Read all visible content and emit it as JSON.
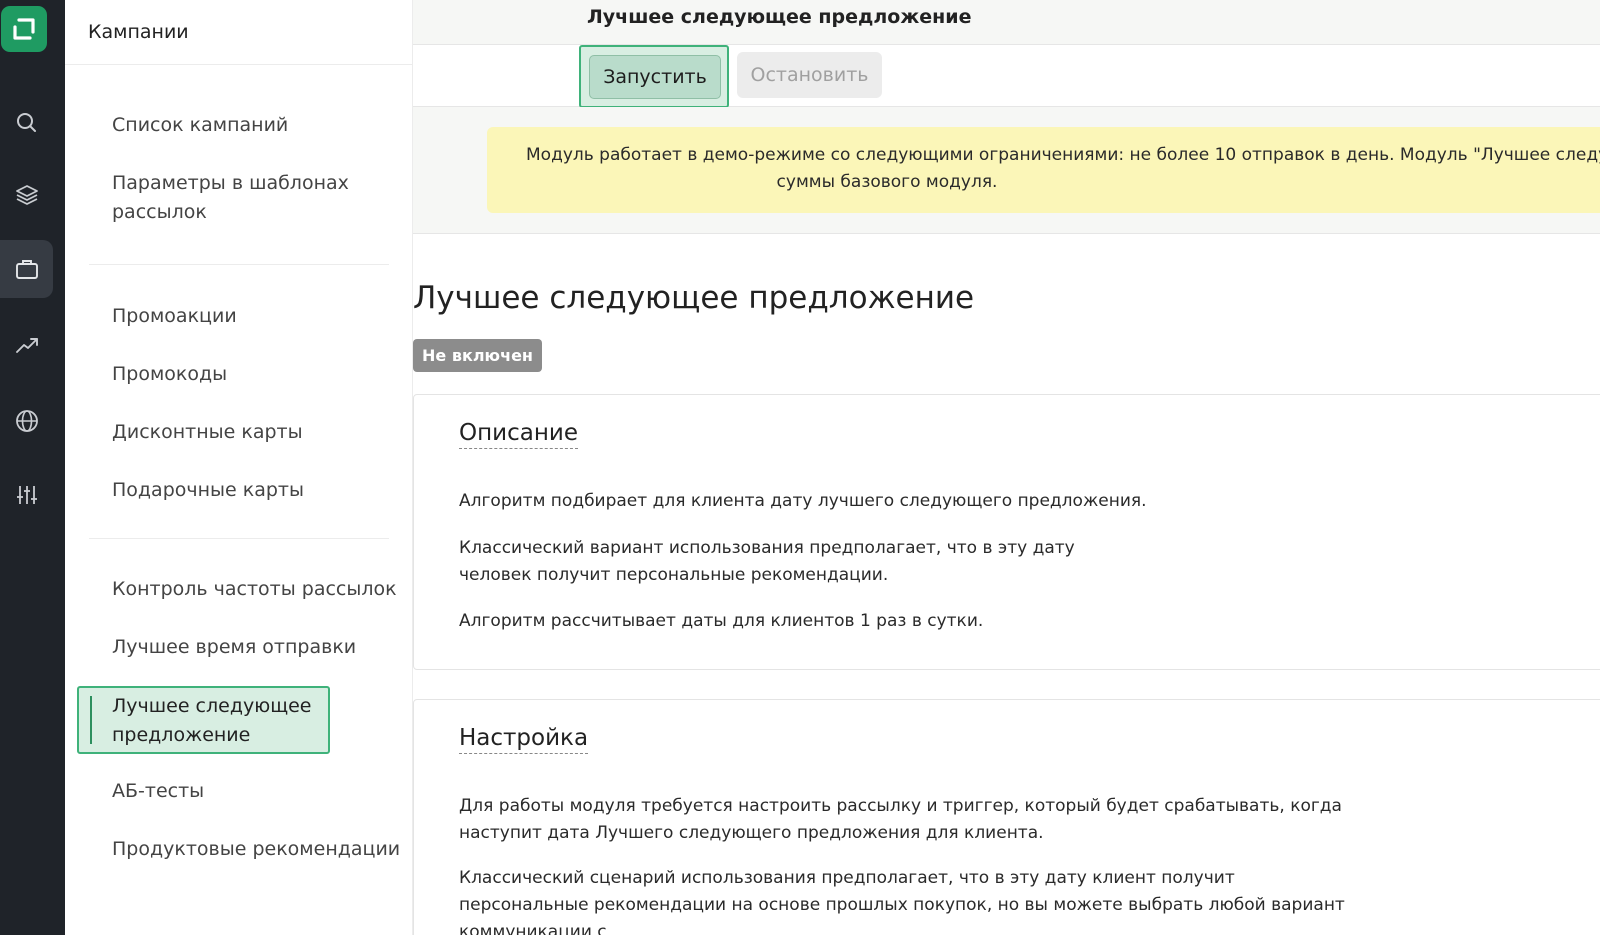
{
  "sidebar": {
    "title": "Кампании",
    "items": [
      {
        "label": "Список кампаний"
      },
      {
        "label": "Параметры в шаблонах рассылок"
      },
      {
        "label": "Промоакции"
      },
      {
        "label": "Промокоды"
      },
      {
        "label": "Дисконтные карты"
      },
      {
        "label": "Подарочные карты"
      },
      {
        "label": "Контроль частоты рассылок"
      },
      {
        "label": "Лучшее время отправки"
      },
      {
        "label": "Лучшее следующее предложение"
      },
      {
        "label": "АБ-тесты"
      },
      {
        "label": "Продуктовые рекомендации"
      }
    ]
  },
  "topbar": {
    "title": "Лучшее следующее предложение"
  },
  "toolbar": {
    "start_label": "Запустить",
    "stop_label": "Остановить"
  },
  "notice": {
    "line1": "Модуль работает в демо-режиме со следующими ограничениями: не более 10 отправок в день. Модуль \"Лучшее следую",
    "line2": "суммы базового модуля."
  },
  "page": {
    "title": "Лучшее следующее предложение",
    "status": "Не включен"
  },
  "description": {
    "title": "Описание",
    "p1": "Алгоритм подбирает для клиента дату лучшего следующего предложения.",
    "p2": "Классический вариант использования предполагает, что в эту дату человек получит персональные рекомендации.",
    "p3": "Алгоритм рассчитывает даты для клиентов 1 раз в сутки."
  },
  "setup": {
    "title": "Настройка",
    "p1": "Для работы модуля требуется настроить рассылку и триггер, который будет срабатывать, когда наступит дата Лучшего следующего предложения для клиента.",
    "p2": "Классический сценарий использования предполагает, что в эту дату клиент получит персональные рекомендации на основе прошлых покупок, но вы можете выбрать любой вариант коммуникации с"
  },
  "colors": {
    "rail": "#1f2329",
    "brand": "#1f9b62",
    "highlight": "#3fb27a",
    "notice": "#fbf6b8",
    "badge": "#8c8c8c"
  }
}
